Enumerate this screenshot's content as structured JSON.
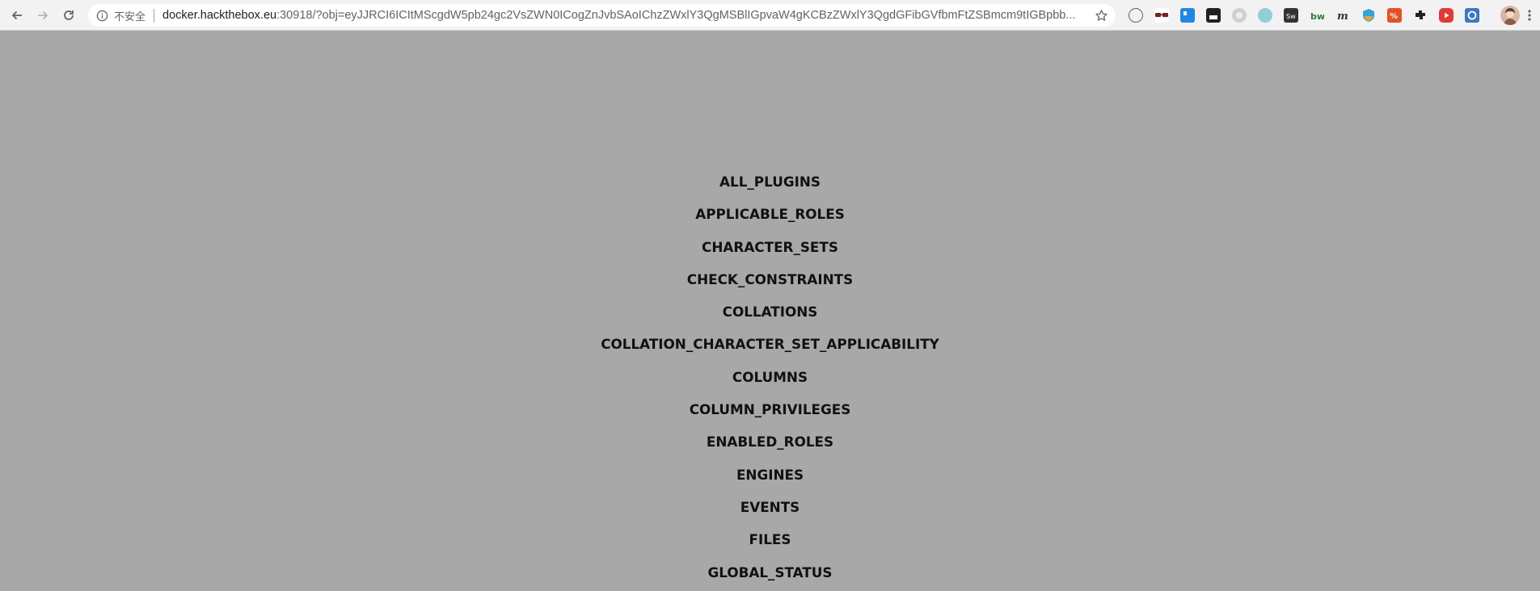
{
  "browser": {
    "security_label": "不安全",
    "url_host": "docker.hackthebox.eu",
    "url_path": ":30918/?obj=eyJJRCI6ICItMScgdW5pb24gc2VsZWN0ICogZnJvbSAoIChzZWxlY3QgMSBlIGpvaW4gKCBzZWxlY3QgdGFibGVfbmFtZSBmcm9tIGBpbb..."
  },
  "tables": [
    "ALL_PLUGINS",
    "APPLICABLE_ROLES",
    "CHARACTER_SETS",
    "CHECK_CONSTRAINTS",
    "COLLATIONS",
    "COLLATION_CHARACTER_SET_APPLICABILITY",
    "COLUMNS",
    "COLUMN_PRIVILEGES",
    "ENABLED_ROLES",
    "ENGINES",
    "EVENTS",
    "FILES",
    "GLOBAL_STATUS"
  ],
  "colors": {
    "page_background": "#a8a8a8",
    "toolbar_background": "#f2f2f2",
    "text": "#111111"
  },
  "extensions": [
    "reading-glasses-icon",
    "square-blue-icon",
    "ghost-icon",
    "gear-grey-icon",
    "circle-teal-icon",
    "sw-icon",
    "bw-icon",
    "m-icon",
    "shield-icon",
    "percent-orange-icon",
    "puzzle-icon",
    "youtube-red-icon",
    "refresh-blue-icon"
  ]
}
